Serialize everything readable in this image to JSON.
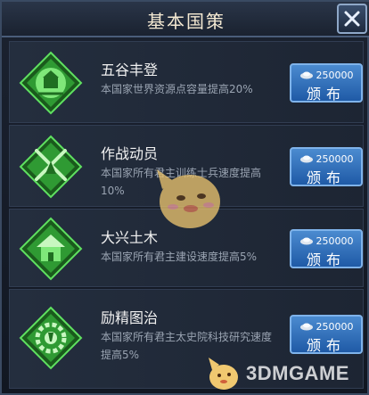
{
  "header": {
    "title": "基本国策"
  },
  "policies": [
    {
      "name": "五谷丰登",
      "desc": "本国家世界资源点容量提高20%",
      "cost": "250000",
      "button": "颁布",
      "icon": "harvest-icon"
    },
    {
      "name": "作战动员",
      "desc": "本国家所有君主训练士兵速度提高10%",
      "cost": "250000",
      "button": "颁布",
      "icon": "swords-icon"
    },
    {
      "name": "大兴土木",
      "desc": "本国家所有君主建设速度提高5%",
      "cost": "250000",
      "button": "颁布",
      "icon": "building-icon"
    },
    {
      "name": "励精图治",
      "desc": "本国家所有君主太史院科技研究速度提高5%",
      "cost": "250000",
      "button": "颁布",
      "icon": "research-gear-icon"
    }
  ],
  "watermark": {
    "text": "3DMGAME"
  },
  "colors": {
    "accent_green": "#35c83a",
    "button_blue": "#2f6fc0"
  }
}
